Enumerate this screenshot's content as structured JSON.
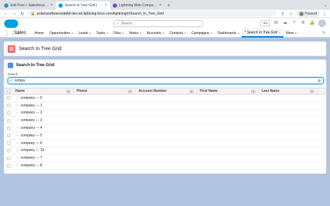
{
  "browser": {
    "tabs": [
      {
        "title": "Edit Post < Salesforce Diaries",
        "favicon_color": "#1f8ed0",
        "active": false
      },
      {
        "title": "Search In Tree Grid | Salesforce",
        "favicon_color": "#00a1e0",
        "active": true
      },
      {
        "title": "Lightning Web Component A",
        "favicon_color": "#7a3fc6",
        "active": false
      }
    ],
    "url": "polarissoftwareslabltd-dev-ed.lightning.force.com/lightning/n/Search_In_Tree_Grid",
    "profile_status": "Paused"
  },
  "sf": {
    "global_search_placeholder": "Search...",
    "app_name": "Sales",
    "nav_items": [
      {
        "label": "Home",
        "dropdown": false
      },
      {
        "label": "Opportunities",
        "dropdown": true
      },
      {
        "label": "Leads",
        "dropdown": true
      },
      {
        "label": "Tasks",
        "dropdown": true
      },
      {
        "label": "Files",
        "dropdown": true
      },
      {
        "label": "Notes",
        "dropdown": true
      },
      {
        "label": "Accounts",
        "dropdown": true
      },
      {
        "label": "Contacts",
        "dropdown": true
      },
      {
        "label": "Campaigns",
        "dropdown": true
      },
      {
        "label": "Dashboards",
        "dropdown": true
      },
      {
        "label": "* Search In Tree Grid",
        "dropdown": false,
        "active": true
      },
      {
        "label": "More",
        "dropdown": true
      }
    ]
  },
  "page": {
    "title": "Search In Tree Grid"
  },
  "card": {
    "title": "Search In Tree Grid",
    "search_label": "Search:",
    "search_value": "compa"
  },
  "grid": {
    "columns": [
      "Name",
      "Phone",
      "Account Number",
      "First Name",
      "Last Name"
    ],
    "rows": [
      "company --- 0",
      "company --- 1",
      "company --- 2",
      "company --- 3",
      "company --- 4",
      "company --- 5",
      "company --- 6",
      "company --- 10",
      "company --- 7",
      "company --- 8"
    ]
  },
  "colors": {
    "accent": "#0176d3",
    "background": "#b0c4df",
    "page_icon": "#e56e6e"
  }
}
